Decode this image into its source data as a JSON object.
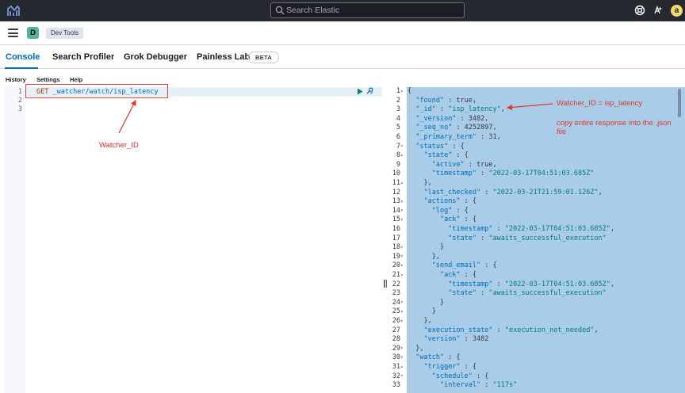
{
  "header": {
    "search_placeholder": "Search Elastic",
    "avatar_initial": "a"
  },
  "breadcrumb": {
    "space_initial": "D",
    "current": "Dev Tools"
  },
  "tabs": [
    {
      "label": "Console",
      "active": true
    },
    {
      "label": "Search Profiler",
      "active": false
    },
    {
      "label": "Grok Debugger",
      "active": false
    },
    {
      "label": "Painless Lab",
      "active": false
    }
  ],
  "beta_badge": "BETA",
  "console_menu": [
    "History",
    "Settings",
    "Help"
  ],
  "request": {
    "line_numbers": [
      "1",
      "2",
      "3"
    ],
    "method": "GET",
    "path": "_watcher/watch/isp_latency"
  },
  "response": {
    "lines": [
      "{",
      "  \"found\" : true,",
      "  \"_id\" : \"isp_latency\",",
      "  \"_version\" : 3482,",
      "  \"_seq_no\" : 4252897,",
      "  \"_primary_term\" : 31,",
      "  \"status\" : {",
      "    \"state\" : {",
      "      \"active\" : true,",
      "      \"timestamp\" : \"2022-03-17T04:51:03.685Z\"",
      "    },",
      "    \"last_checked\" : \"2022-03-21T21:59:01.126Z\",",
      "    \"actions\" : {",
      "      \"log\" : {",
      "        \"ack\" : {",
      "          \"timestamp\" : \"2022-03-17T04:51:03.685Z\",",
      "          \"state\" : \"awaits_successful_execution\"",
      "        }",
      "      },",
      "      \"send_email\" : {",
      "        \"ack\" : {",
      "          \"timestamp\" : \"2022-03-17T04:51:03.685Z\",",
      "          \"state\" : \"awaits_successful_execution\"",
      "        }",
      "      }",
      "    },",
      "    \"execution_state\" : \"execution_not_needed\",",
      "    \"version\" : 3482",
      "  },",
      "  \"watch\" : {",
      "    \"trigger\" : {",
      "      \"schedule\" : {",
      "        \"interval\" : \"117s\""
    ],
    "foldable": [
      1,
      7,
      8,
      11,
      13,
      14,
      15,
      18,
      19,
      20,
      21,
      24,
      25,
      26,
      29,
      30,
      31,
      32
    ]
  },
  "annotations": {
    "watcher_id_label": "Watcher_ID",
    "watcher_id_eq": "Watcher_ID = isp_latency",
    "copy_note_line1": "copy entire response into the .json",
    "copy_note_line2": "file",
    "color": "#e0342a"
  },
  "colors": {
    "header_bg": "#25282f",
    "accent": "#006bb8",
    "response_highlight": "#a9cde8",
    "avatar": "#f1d86f",
    "space_badge": "#54b399"
  }
}
